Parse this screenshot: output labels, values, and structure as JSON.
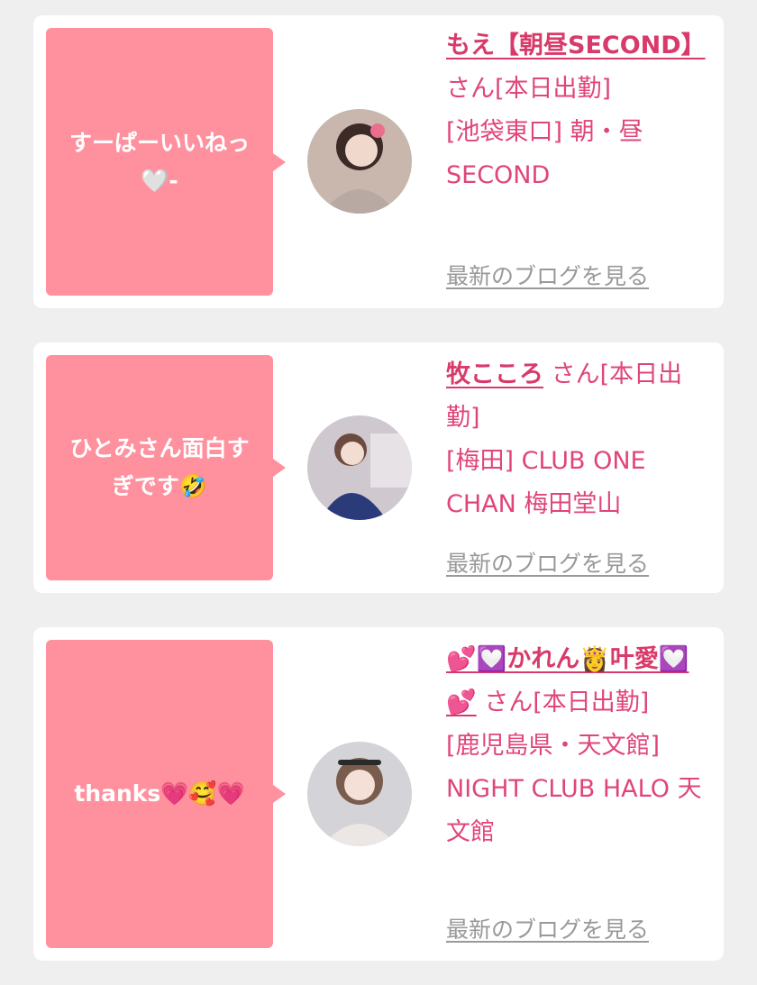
{
  "cards": [
    {
      "message": "すーぱーいいねっ🤍-",
      "girl_name": "もえ【朝昼SECOND】",
      "suffix": "さん[本日出勤]",
      "location": "[池袋東口] 朝・昼SECOND",
      "blog_link": "最新のブログを見る"
    },
    {
      "message": "ひとみさん面白すぎです🤣",
      "girl_name": "牧こころ",
      "suffix": "さん[本日出勤]",
      "location": "[梅田] CLUB ONE CHAN 梅田堂山",
      "blog_link": "最新のブログを見る"
    },
    {
      "message": "thanks💗🥰💗",
      "girl_name": "💕💟かれん👸叶愛💟💕",
      "suffix": "さん[本日出勤]",
      "location": "[鹿児島県・天文館] NIGHT CLUB HALO 天文館",
      "blog_link": "最新のブログを見る"
    }
  ]
}
